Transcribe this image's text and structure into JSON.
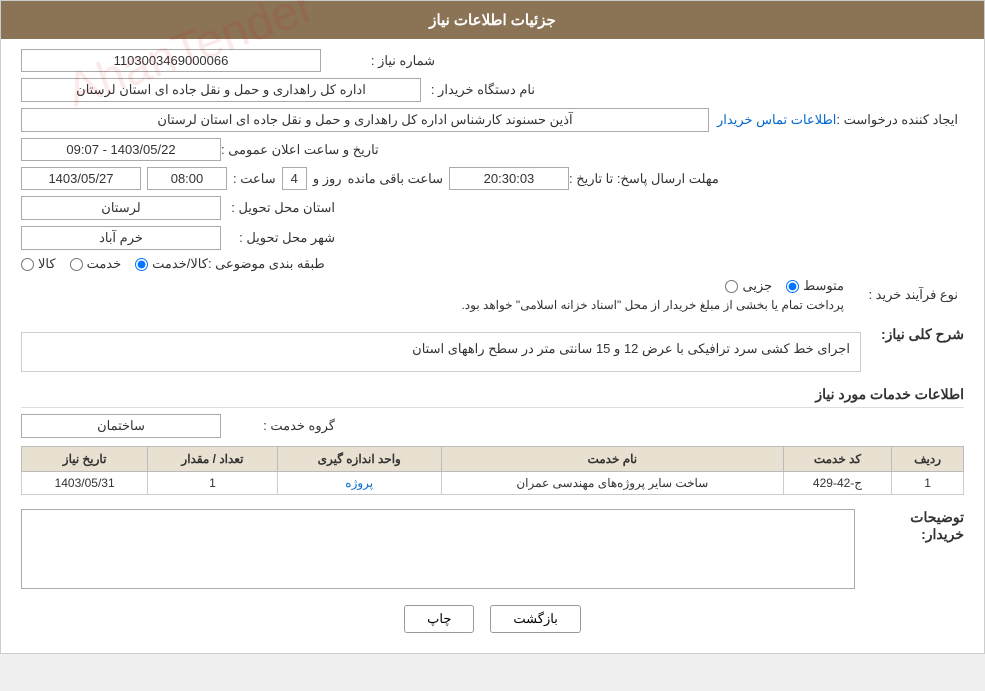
{
  "header": {
    "title": "جزئیات اطلاعات نیاز"
  },
  "need_info": {
    "section_title": "جزئیات اطلاعات نیاز",
    "shomara_niaz_label": "شماره نیاز :",
    "shomara_niaz_value": "1103003469000066",
    "name_dastgah_label": "نام دستگاه خریدار :",
    "name_dastgah_value": "اداره کل راهداری و حمل و نقل جاده ای استان لرستان",
    "ijad_label": "ایجاد کننده درخواست :",
    "ijad_value": "آذین حسنوند کارشناس اداره کل راهداری و حمل و نقل جاده ای استان لرستان",
    "ijad_link": "اطلاعات تماس خریدار",
    "tarikh_elan_label": "تاریخ و ساعت اعلان عمومی :",
    "tarikh_elan_value": "1403/05/22 - 09:07",
    "mohlat_label": "مهلت ارسال پاسخ: تا تاریخ :",
    "mohlat_date": "1403/05/27",
    "mohlat_saat_label": "ساعت :",
    "mohlat_saat": "08:00",
    "mohlat_rooz_label": "روز و",
    "mohlat_rooz": "4",
    "mohlat_saatmande_label": "ساعت باقی مانده",
    "mohlat_baqi": "20:30:03",
    "ostan_tahvil_label": "استان محل تحویل :",
    "ostan_tahvil_value": "لرستان",
    "shahr_tahvil_label": "شهر محل تحویل :",
    "shahr_tahvil_value": "خرم آباد",
    "tabaqe_label": "طبقه بندی موضوعی :",
    "tabaqe_kala": "کالا",
    "tabaqe_khedmat": "خدمت",
    "tabaqe_kala_khedmat": "کالا/خدمت",
    "tabaqe_selected": "kala_khedmat",
    "nooe_farayand_label": "نوع فرآیند خرید :",
    "nooe_jazee": "جزیی",
    "nooe_motevaset": "متوسط",
    "nooe_description": "پرداخت تمام یا بخشی از مبلغ خریدار از محل \"اسناد خزانه اسلامی\" خواهد بود.",
    "nooe_selected": "motevaset"
  },
  "sharh_niaz": {
    "label": "شرح کلی نیاز:",
    "value": "اجرای خط کشی سرد ترافیکی با عرض 12 و 15 سانتی متر در سطح راههای استان"
  },
  "khadamat": {
    "section_title": "اطلاعات خدمات مورد نیاز",
    "group_label": "گروه خدمت :",
    "group_value": "ساختمان"
  },
  "table": {
    "cols": [
      "ردیف",
      "کد خدمت",
      "نام خدمت",
      "واحد اندازه گیری",
      "تعداد / مقدار",
      "تاریخ نیاز"
    ],
    "rows": [
      {
        "radif": "1",
        "code": "ج-42-429",
        "name": "ساخت سایر پروژه‌های مهندسی عمران",
        "unit": "پروژه",
        "count": "1",
        "date": "1403/05/31"
      }
    ]
  },
  "toseef": {
    "label": "توضیحات خریدار:",
    "value": ""
  },
  "buttons": {
    "print": "چاپ",
    "back": "بازگشت"
  }
}
